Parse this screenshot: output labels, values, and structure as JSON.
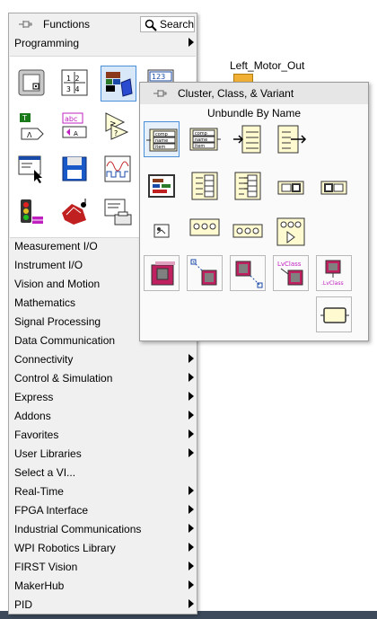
{
  "background": {
    "indicator_label": "Left_Motor_Out"
  },
  "palette": {
    "title": "Functions",
    "search_label": "Search",
    "top_category": "Programming",
    "icons": [
      {
        "name": "structures-icon"
      },
      {
        "name": "array-icon"
      },
      {
        "name": "cluster-class-variant-icon",
        "selected": true
      },
      {
        "name": "numeric-icon"
      },
      {
        "name": "boolean-icon"
      },
      {
        "name": "string-icon"
      },
      {
        "name": "comparison-icon"
      },
      {
        "name": "timing-icon"
      },
      {
        "name": "dialog-ui-icon"
      },
      {
        "name": "file-io-icon"
      },
      {
        "name": "waveform-icon"
      },
      {
        "name": "application-control-icon"
      },
      {
        "name": "synchronization-icon"
      },
      {
        "name": "graphics-sound-icon"
      },
      {
        "name": "report-generation-icon"
      }
    ],
    "categories": [
      {
        "label": "Measurement I/O",
        "submenu": false
      },
      {
        "label": "Instrument I/O",
        "submenu": false
      },
      {
        "label": "Vision and Motion",
        "submenu": false
      },
      {
        "label": "Mathematics",
        "submenu": false
      },
      {
        "label": "Signal Processing",
        "submenu": false
      },
      {
        "label": "Data Communication",
        "submenu": false
      },
      {
        "label": "Connectivity",
        "submenu": true
      },
      {
        "label": "Control & Simulation",
        "submenu": true
      },
      {
        "label": "Express",
        "submenu": true
      },
      {
        "label": "Addons",
        "submenu": true
      },
      {
        "label": "Favorites",
        "submenu": true
      },
      {
        "label": "User Libraries",
        "submenu": true
      },
      {
        "label": "Select a VI...",
        "submenu": false
      },
      {
        "label": "Real-Time",
        "submenu": true
      },
      {
        "label": "FPGA Interface",
        "submenu": true
      },
      {
        "label": "Industrial Communications",
        "submenu": true
      },
      {
        "label": "WPI Robotics Library",
        "submenu": true
      },
      {
        "label": "FIRST Vision",
        "submenu": true
      },
      {
        "label": "MakerHub",
        "submenu": true
      },
      {
        "label": "PID",
        "submenu": true
      }
    ]
  },
  "cluster_palette": {
    "title": "Cluster, Class, & Variant",
    "hovered_item": "Unbundle By Name",
    "icons": [
      {
        "name": "unbundle-by-name-icon",
        "selected": true
      },
      {
        "name": "bundle-by-name-icon"
      },
      {
        "name": "unbundle-icon"
      },
      {
        "name": "bundle-icon"
      },
      {
        "name": "cluster-constant-icon"
      },
      {
        "name": "build-cluster-array-icon"
      },
      {
        "name": "index-bundle-cluster-array-icon"
      },
      {
        "name": "cluster-to-array-icon"
      },
      {
        "name": "array-to-cluster-icon"
      },
      {
        "name": "variant-constant-icon"
      },
      {
        "name": "variant-to-data-icon"
      },
      {
        "name": "to-variant-icon"
      },
      {
        "name": "variant-attribute-icon"
      },
      {
        "name": "class-constant-icon"
      },
      {
        "name": "to-more-generic-class-icon"
      },
      {
        "name": "to-more-specific-class-icon"
      },
      {
        "name": "get-lv-class-path-icon"
      },
      {
        "name": "get-lv-class-default-value-icon"
      },
      {
        "name": "cluster-object-icon"
      }
    ]
  }
}
